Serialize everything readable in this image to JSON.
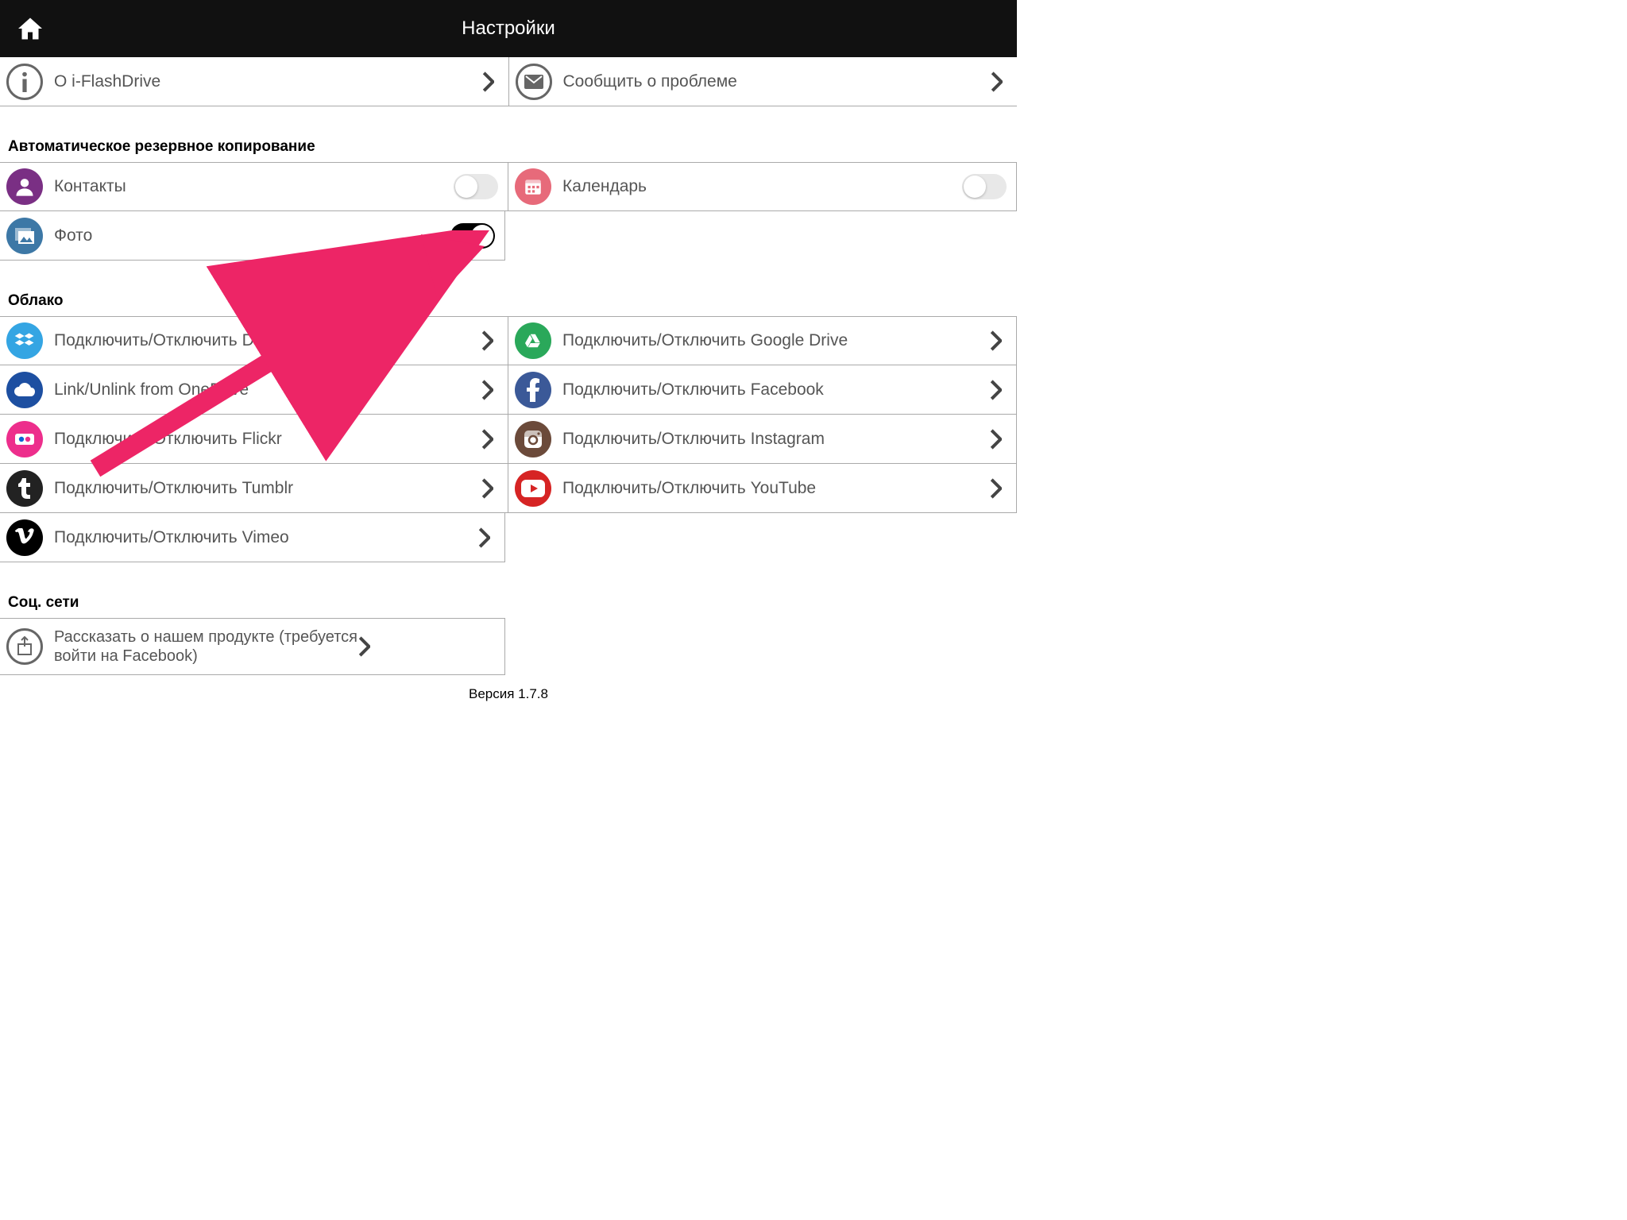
{
  "header": {
    "title": "Настройки"
  },
  "top": {
    "about": "О i-FlashDrive",
    "report": "Сообщить о проблеме"
  },
  "backup": {
    "heading": "Автоматическое резервное копирование",
    "contacts": {
      "label": "Контакты",
      "on": false
    },
    "calendar": {
      "label": "Календарь",
      "on": false
    },
    "photo": {
      "label": "Фото",
      "on": true
    }
  },
  "cloud": {
    "heading": "Облако",
    "dropbox": "Подключить/Отключить Dropbox",
    "gdrive": "Подключить/Отключить Google Drive",
    "onedrive": "Link/Unlink from OneDrive",
    "facebook": "Подключить/Отключить Facebook",
    "flickr": "Подключить/Отключить  Flickr",
    "instagram": "Подключить/Отключить Instagram",
    "tumblr": "Подключить/Отключить Tumblr",
    "youtube": "Подключить/Отключить YouTube",
    "vimeo": "Подключить/Отключить Vimeo"
  },
  "social": {
    "heading": "Соц. сети",
    "share_l1": "Рассказать о нашем продукте (требуется",
    "share_l2": "войти на Facebook)"
  },
  "footer": {
    "version": "Версия 1.7.8"
  },
  "colors": {
    "contacts": "#7a2f84",
    "calendar": "#e76a7a",
    "photo": "#3d78a6",
    "dropbox": "#34a5e3",
    "gdrive": "#2aa85a",
    "onedrive": "#1d4fa1",
    "facebook": "#3b5998",
    "flickr": "#ed2e8c",
    "instagram": "#6b4a3a",
    "tumblr": "#222",
    "youtube": "#d62424",
    "vimeo": "#000",
    "share": "#fff"
  }
}
